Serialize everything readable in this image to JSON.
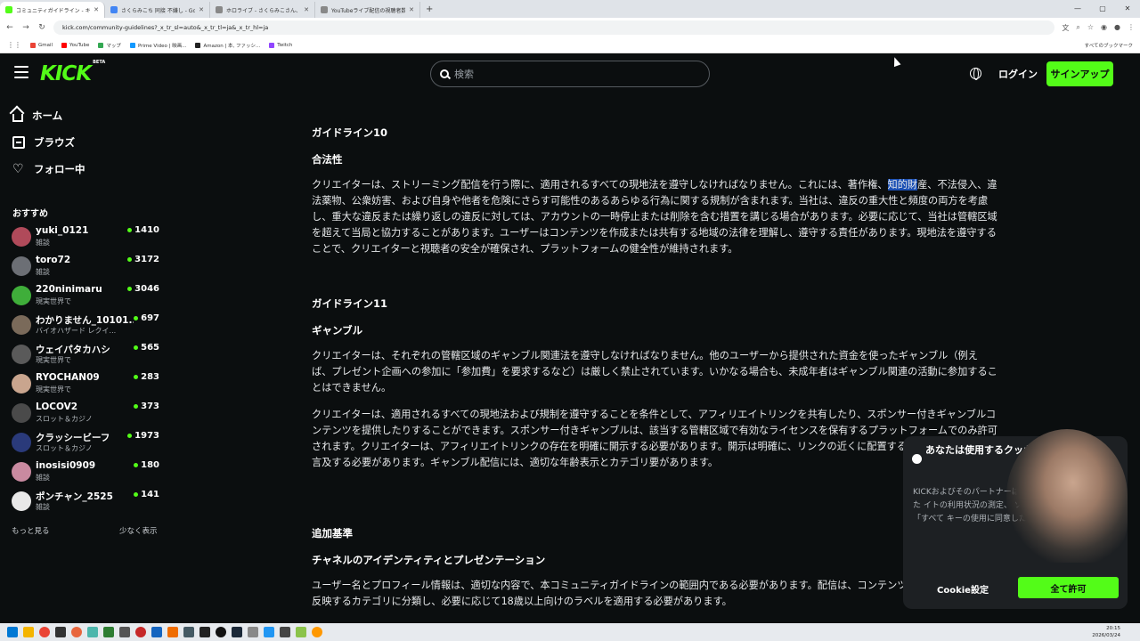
{
  "browser": {
    "tabs": [
      {
        "title": "コミュニティガイドライン - キックストリ",
        "color": "#53fc18",
        "active": true
      },
      {
        "title": "さくらみこち 同接 不嫌し - Googl",
        "color": "#4285f4",
        "active": false
      },
      {
        "title": "ホロライブ - さくらみこさん、配信の…",
        "color": "#888888",
        "active": false
      },
      {
        "title": "YouTubeライブ配信の視聴者数仕…",
        "color": "#888888",
        "active": false
      }
    ],
    "url": "kick.com/community-guidelines?_x_tr_sl=auto&_x_tr_tl=ja&_x_tr_hl=ja",
    "bookmarks": [
      {
        "label": "Gmail",
        "color": "#ea4335"
      },
      {
        "label": "YouTube",
        "color": "#ff0000"
      },
      {
        "label": "マップ",
        "color": "#34a853"
      },
      {
        "label": "Prime Video | 映画...",
        "color": "#1399ff"
      },
      {
        "label": "Amazon | 本, ファッシ...",
        "color": "#222222"
      },
      {
        "label": "Twitch",
        "color": "#9146ff"
      }
    ],
    "bookmarks_right": "すべてのブックマーク"
  },
  "header": {
    "logo": "KICK",
    "logo_badge": "BETA",
    "search_placeholder": "検索",
    "login_label": "ログイン",
    "signup_label": "サインアップ"
  },
  "sidebar": {
    "nav": [
      {
        "label": "ホーム",
        "icon": "home-icon"
      },
      {
        "label": "ブラウズ",
        "icon": "browse-icon"
      },
      {
        "label": "フォロー中",
        "icon": "heart-icon"
      }
    ],
    "recommended_title": "おすすめ",
    "channels": [
      {
        "name": "yuki_0121",
        "category": "雑談",
        "viewers": "1410",
        "color": "#b04a5a"
      },
      {
        "name": "toro72",
        "category": "雑談",
        "viewers": "3172",
        "color": "#6c6f75"
      },
      {
        "name": "220ninimaru",
        "category": "現実世界で",
        "viewers": "3046",
        "color": "#3fae3a"
      },
      {
        "name": "わかりません_10101...",
        "category": "バイオハザード レクイ...",
        "viewers": "697",
        "color": "#7a6a5a"
      },
      {
        "name": "ウェイパタカハシ",
        "category": "現実世界で",
        "viewers": "565",
        "color": "#5a5a5a"
      },
      {
        "name": "RYOCHAN09",
        "category": "現実世界で",
        "viewers": "283",
        "color": "#c9a58e"
      },
      {
        "name": "LOCOV2",
        "category": "スロット＆カジノ",
        "viewers": "373",
        "color": "#4a4a4a"
      },
      {
        "name": "クラッシービーフ",
        "category": "スロット＆カジノ",
        "viewers": "1973",
        "color": "#2a3a7a"
      },
      {
        "name": "inosisi0909",
        "category": "雑談",
        "viewers": "180",
        "color": "#c98aa0"
      },
      {
        "name": "ポンチャン_2525",
        "category": "雑談",
        "viewers": "141",
        "color": "#e8e8e8"
      }
    ],
    "show_more": "もっと見る",
    "show_less": "少なく表示"
  },
  "content": {
    "g10_title": "ガイドライン10",
    "g10_subtitle": "合法性",
    "g10_text_a": "クリエイターは、ストリーミング配信を行う際に、適用されるすべての現地法を遵守しなければなりません。これには、著作権、",
    "g10_text_hl": "知的財",
    "g10_text_b": "産、不法侵入、違法薬物、公衆妨害、および自身や他者を危険にさらす可能性のあるあらゆる行為に関する規制が含まれます。当社は、違反の重大性と頻度の両方を考慮し、重大な違反または繰り返しの違反に対しては、アカウントの一時停止または削除を含む措置を講じる場合があります。必要に応じて、当社は管轄区域を超えて当局と協力することがあります。ユーザーはコンテンツを作成または共有する地域の法律を理解し、遵守する責任があります。現地法を遵守することで、クリエイターと視聴者の安全が確保され、プラットフォームの健全性が維持されます。",
    "g11_title": "ガイドライン11",
    "g11_subtitle": "ギャンブル",
    "g11_text1": "クリエイターは、それぞれの管轄区域のギャンブル関連法を遵守しなければなりません。他のユーザーから提供された資金を使ったギャンブル（例えば、プレゼント企画への参加に「参加費」を要求するなど）は厳しく禁止されています。いかなる場合も、未成年者はギャンブル関連の活動に参加することはできません。",
    "g11_text2": "クリエイターは、適用されるすべての現地法および規制を遵守することを条件として、アフィリエイトリンクを共有したり、スポンサー付きギャンブルコンテンツを提供したりすることができます。スポンサー付きギャンブルは、該当する管轄区域で有効なライセンスを保有するプラットフォームでのみ許可されます。クリエイターは、アフィリエイトリンクの存在を明確に開示する必要があります。開示は明確に、リンクの近くに配置するか、配信中に音声で言及する必要があります。ギャンブル配信には、適切な年齢表示とカテゴリ要があります。",
    "extra_title": "追加基準",
    "extra_subtitle": "チャネルのアイデンティティとプレゼンテーション",
    "extra_text": "ユーザー名とプロフィール情報は、適切な内容で、本コミュニティガイドラインの範囲内である必要があります。配信は、コンテンツの性質を最も正確に反映するカテゴリに分類し、必要に応じて18歳以上向けのラベルを適用する必要があります。"
  },
  "cookie": {
    "title": "あなたは使用するクッキーを ます",
    "body": "KICKおよびそのパートナーは、上、パーソナライズされた イトの利用状況の測定、 ソーシャルメディ します。「すべて キーの使用に同意したことになります。",
    "settings_label": "Cookie設定",
    "allow_label": "全て許可"
  },
  "taskbar": {
    "time": "20:15",
    "date": "2026/03/24"
  }
}
